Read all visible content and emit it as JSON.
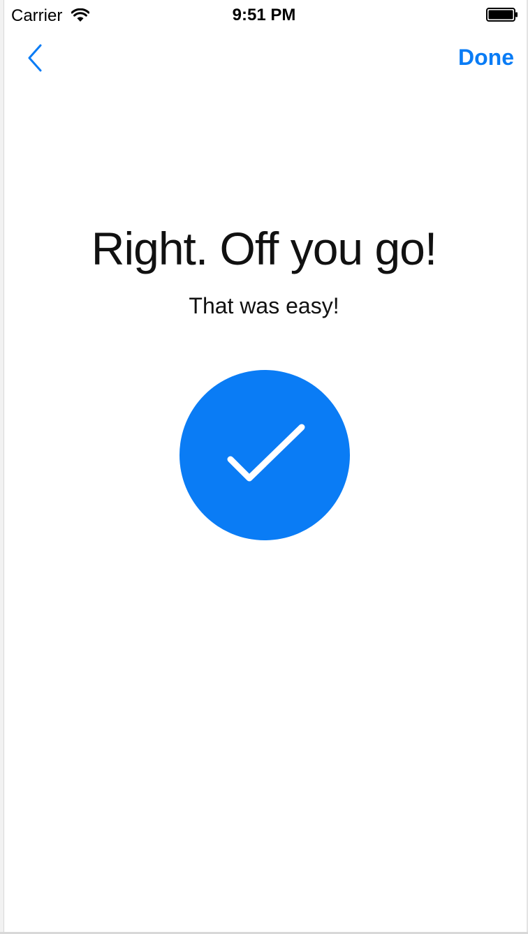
{
  "status_bar": {
    "carrier": "Carrier",
    "time": "9:51 PM",
    "wifi_icon": "wifi-icon",
    "battery_icon": "battery-icon"
  },
  "nav": {
    "back_icon": "chevron-left-icon",
    "done_label": "Done"
  },
  "main": {
    "title": "Right. Off you go!",
    "subtitle": "That was easy!",
    "checkmark_icon": "checkmark-icon"
  },
  "colors": {
    "accent": "#0a7cf5",
    "text": "#111111",
    "background": "#ffffff"
  }
}
